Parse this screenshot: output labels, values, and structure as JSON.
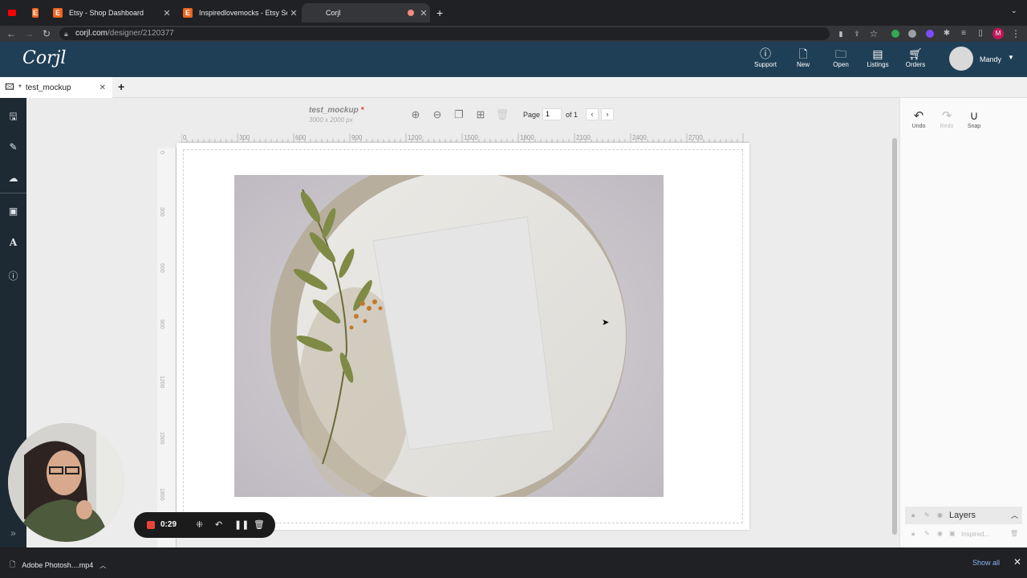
{
  "browser": {
    "tabs": [
      {
        "title": "",
        "icon": "youtube-icon"
      },
      {
        "title": "",
        "icon": "etsy-icon"
      },
      {
        "title": "Etsy - Shop Dashboard",
        "icon": "etsy-icon"
      },
      {
        "title": "Inspiredlovemocks - Etsy Sout",
        "icon": "etsy-icon"
      },
      {
        "title": "Corjl",
        "icon": "corjl-icon",
        "active": true
      }
    ],
    "url_host": "corjl.com",
    "url_path": "/designer/2120377",
    "profile_initial": "M"
  },
  "header": {
    "logo": "Corjl",
    "nav": [
      {
        "label": "Support",
        "icon": "help-icon"
      },
      {
        "label": "New",
        "icon": "new-file-icon"
      },
      {
        "label": "Open",
        "icon": "folder-icon"
      },
      {
        "label": "Listings",
        "icon": "listings-icon"
      },
      {
        "label": "Orders",
        "icon": "cart-icon"
      }
    ],
    "username": "Mandy"
  },
  "document_tab": {
    "label": "test_mockup",
    "modified_marker": "*"
  },
  "left_rail": [
    "save-icon",
    "edit-icon",
    "cloud-upload-icon",
    "image-icon",
    "text-icon",
    "info-icon"
  ],
  "canvas": {
    "doc_name": "test_mockup",
    "modified_marker": "*",
    "dimensions": "3000 x 2000 px",
    "page_label": "Page",
    "page_value": "1",
    "page_of": "of 1",
    "hruler": [
      "0",
      "300",
      "600",
      "900",
      "1200",
      "1500",
      "1800",
      "2100",
      "2400",
      "2700"
    ],
    "vruler": [
      "0",
      "300",
      "600",
      "900",
      "1200",
      "1500",
      "1800"
    ]
  },
  "right_panel": {
    "undo": "Undo",
    "redo": "Redo",
    "snap": "Snap",
    "layers_title": "Layers",
    "layer_item": "Inspired..."
  },
  "recorder": {
    "time": "0:29"
  },
  "download": {
    "file": "Adobe Photosh....mp4",
    "show_all": "Show all"
  },
  "colors": {
    "header_bg": "#1f3f56",
    "left_rail_bg": "#1e2a33",
    "record_red": "#e8443a"
  }
}
